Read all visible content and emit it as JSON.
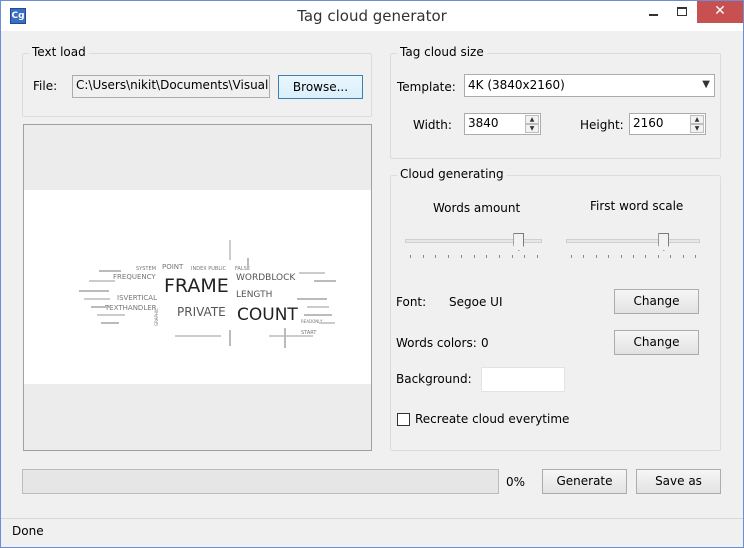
{
  "window": {
    "title": "Tag cloud generator",
    "icon_text": "Cg",
    "controls": {
      "minimize": "—",
      "maximize": "",
      "close": "✕"
    }
  },
  "text_load": {
    "legend": "Text load",
    "file_label": "File:",
    "file_path": "C:\\Users\\nikit\\Documents\\Visual Stu",
    "browse_label": "Browse..."
  },
  "size": {
    "legend": "Tag cloud size",
    "template_label": "Template:",
    "template_value": "4K (3840x2160)",
    "width_label": "Width:",
    "width_value": "3840",
    "height_label": "Height:",
    "height_value": "2160"
  },
  "generating": {
    "legend": "Cloud generating",
    "words_amount_label": "Words amount",
    "words_amount_level": 0.86,
    "first_word_scale_label": "First word scale",
    "first_word_scale_level": 0.75,
    "font_label": "Font:",
    "font_value": "Segoe UI",
    "font_change_label": "Change",
    "colors_label": "Words colors:",
    "colors_value": "0",
    "colors_change_label": "Change",
    "background_label": "Background:",
    "background_color": "#ffffff",
    "recreate_label": "Recreate cloud everytime",
    "recreate_checked": false
  },
  "progress": {
    "value": 0,
    "text": "0%"
  },
  "actions": {
    "generate_label": "Generate",
    "save_label": "Save as"
  },
  "status": {
    "text": "Done"
  },
  "cloud_words": {
    "frame": "FRAME",
    "count": "COUNT",
    "private": "PRIVATE",
    "wordblock": "WORDBLOCK",
    "length": "LENGTH",
    "frequency": "FREQUENCY",
    "isvertical": "ISVERTICAL",
    "texthandler": "TEXTHANDLER",
    "point": "POINT",
    "system": "SYSTEM",
    "index_public": "INDEX PUBLIC",
    "false": "FALSE",
    "start": "START",
    "graphic": "GRAPHIC",
    "readonly": "READONLY"
  },
  "colors": {
    "accent": "#3c7fb1",
    "close_button": "#c75050",
    "progress_fill": "#06b025"
  }
}
